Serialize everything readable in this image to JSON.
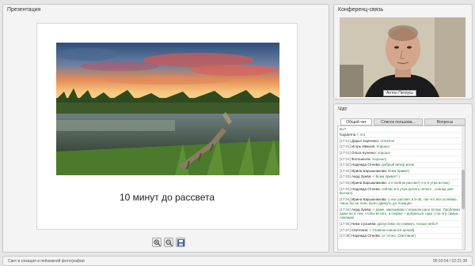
{
  "presentation": {
    "title": "Презентация",
    "slide_caption": "10 минут до рассвета",
    "toolbar": [
      "zoom-in-icon",
      "zoom-out-icon",
      "save-icon"
    ]
  },
  "video": {
    "title": "Конференц-связь",
    "presenter_name": "Антон Петрусь"
  },
  "chat": {
    "title": "Чат",
    "tabs": [
      "Общий чат",
      "Список пользова...",
      "Вопросы"
    ],
    "messages": [
      {
        "time": "",
        "user": "",
        "text": "вы?"
      },
      {
        "time": "",
        "user": "hoguterna",
        "text": "< это"
      },
      {
        "time": "[17:01]",
        "user": "Дарья Харченко:",
        "text": "отлично!"
      },
      {
        "time": "[17:01]",
        "user": "Игорь Иванов:",
        "text": "Хорошо"
      },
      {
        "time": "[17:01]",
        "user": "Ольга Куленко:",
        "text": "хорошо"
      },
      {
        "time": "[17:01]",
        "user": "Фотошкола:",
        "text": "Хорошо)"
      },
      {
        "time": "[17:02]",
        "user": "Надежда Отнева:",
        "text": "добрый вечер всем"
      },
      {
        "time": "[17:02]",
        "user": "Ирина Барышникова:",
        "text": "всем привет)"
      },
      {
        "time": "[17:03]",
        "user": "Аерд Зуева:",
        "text": "< Всем привет! )"
      },
      {
        "time": "[17:03]",
        "user": "Ирина Барышникова:",
        "text": "а я люблю рассвет) я в 5 утра встаю)"
      },
      {
        "time": "[17:04]",
        "user": "Надежда Отнева:",
        "text": "сейчас в 5 утра делать нечего , солнце уже высоко)"
      },
      {
        "time": "[17:04]",
        "user": "Ирина Барышникова:",
        "text": "у нас рассвет в 5-45, так что все успеваю, лишь бы не лень было двинуть до локации"
      },
      {
        "time": "[17:04]",
        "user": "Аерд Зуева:",
        "text": "< даже, заказывают слишком рано встаю. Проблема даже не в том, чтобы встать, а скорее – добраться туда :) но эту самую локацию"
      },
      {
        "time": "[17:05]",
        "user": "Ника Сухшева:",
        "text": "Допустимо ли снимать только небо?"
      },
      {
        "time": "[17:07]",
        "user": "Светлана:",
        "text": "< Главное-нашелся целый)"
      },
      {
        "time": "[17:08]",
        "user": "Надежда Отнева:",
        "text": "от точно, Светлана!)"
      }
    ]
  },
  "status": {
    "title": "Свет и локация в пейзажной фотографии",
    "time": "00:10:54 / 02:21:38"
  }
}
